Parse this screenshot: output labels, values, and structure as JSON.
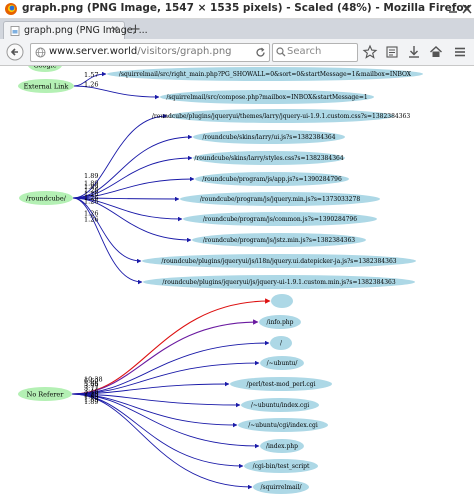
{
  "window": {
    "title": "graph.png (PNG Image, 1547 × 1535 pixels) - Scaled (48%) - Mozilla Firefox"
  },
  "tab": {
    "label": "graph.png (PNG Image, ...",
    "close": "×",
    "new_tab": "+"
  },
  "toolbar": {
    "url_host": "www.server.world",
    "url_path": "/visitors/graph.png",
    "search_placeholder": "Search"
  },
  "graph": {
    "groups": [
      {
        "source": "Google",
        "edges": []
      },
      {
        "source": "External Link",
        "edges": [
          {
            "weight": "1.57",
            "target": "/squirrelmail/src/right_main.php?PG_SHOWALL=0&sort=0&startMessage=1&mailbox=INBOX"
          },
          {
            "weight": "1.26",
            "target": "/squirrelmail/src/compose.php?mailbox=INBOX&startMessage=1"
          }
        ]
      },
      {
        "source": "/roundcube/",
        "edges": [
          {
            "weight": "1.89",
            "target": "/roundcube/plugins/jqueryui/themes/larry/jquery-ui-1.9.1.custom.css?s=1382384363"
          },
          {
            "weight": "1.89",
            "target": "/roundcube/skins/larry/ui.js?s=1382384364"
          },
          {
            "weight": "1.89",
            "target": "/roundcube/skins/larry/styles.css?s=1382384364"
          },
          {
            "weight": "1.26",
            "target": "/roundcube/program/js/app.js?s=1390284796"
          },
          {
            "weight": "1.26",
            "target": "/roundcube/program/js/jquery.min.js?s=1373033278"
          },
          {
            "weight": "1.26",
            "target": "/roundcube/program/js/common.js?s=1390284796"
          },
          {
            "weight": "1.26",
            "target": "/roundcube/program/js/jstz.min.js?s=1382384363"
          },
          {
            "weight": "1.26",
            "target": "/roundcube/plugins/jqueryui/js/i18n/jquery.ui.datepicker-ja.js?s=1382384363"
          },
          {
            "weight": "1.26",
            "target": "/roundcube/plugins/jqueryui/js/jquery-ui-1.9.1.custom.min.js?s=1382384363"
          }
        ]
      },
      {
        "source": "No Referer",
        "edges": [
          {
            "weight": "10.38",
            "target": ""
          },
          {
            "weight": "6.60",
            "target": "/info.php"
          },
          {
            "weight": "5.66",
            "target": "/"
          },
          {
            "weight": "3.77",
            "target": "/~ubuntu/"
          },
          {
            "weight": "3.77",
            "target": "/perl/test-mod_perl.cgi"
          },
          {
            "weight": "3.46",
            "target": "/~ubuntu/index.cgi"
          },
          {
            "weight": "2.20",
            "target": "/~ubuntu/cgi/index.cgi"
          },
          {
            "weight": "1.89",
            "target": "/index.php"
          },
          {
            "weight": "1.89",
            "target": "/cgi-bin/test_script"
          },
          {
            "weight": "1.89",
            "target": "/squirrelmail/"
          }
        ]
      }
    ],
    "colors": {
      "source_node": "#b4f0b4",
      "target_node": "#add8e6",
      "edge_normal": "#1a1aa8",
      "edge_hot": "#dd1111",
      "edge_warm": "#6a1aa0"
    }
  }
}
